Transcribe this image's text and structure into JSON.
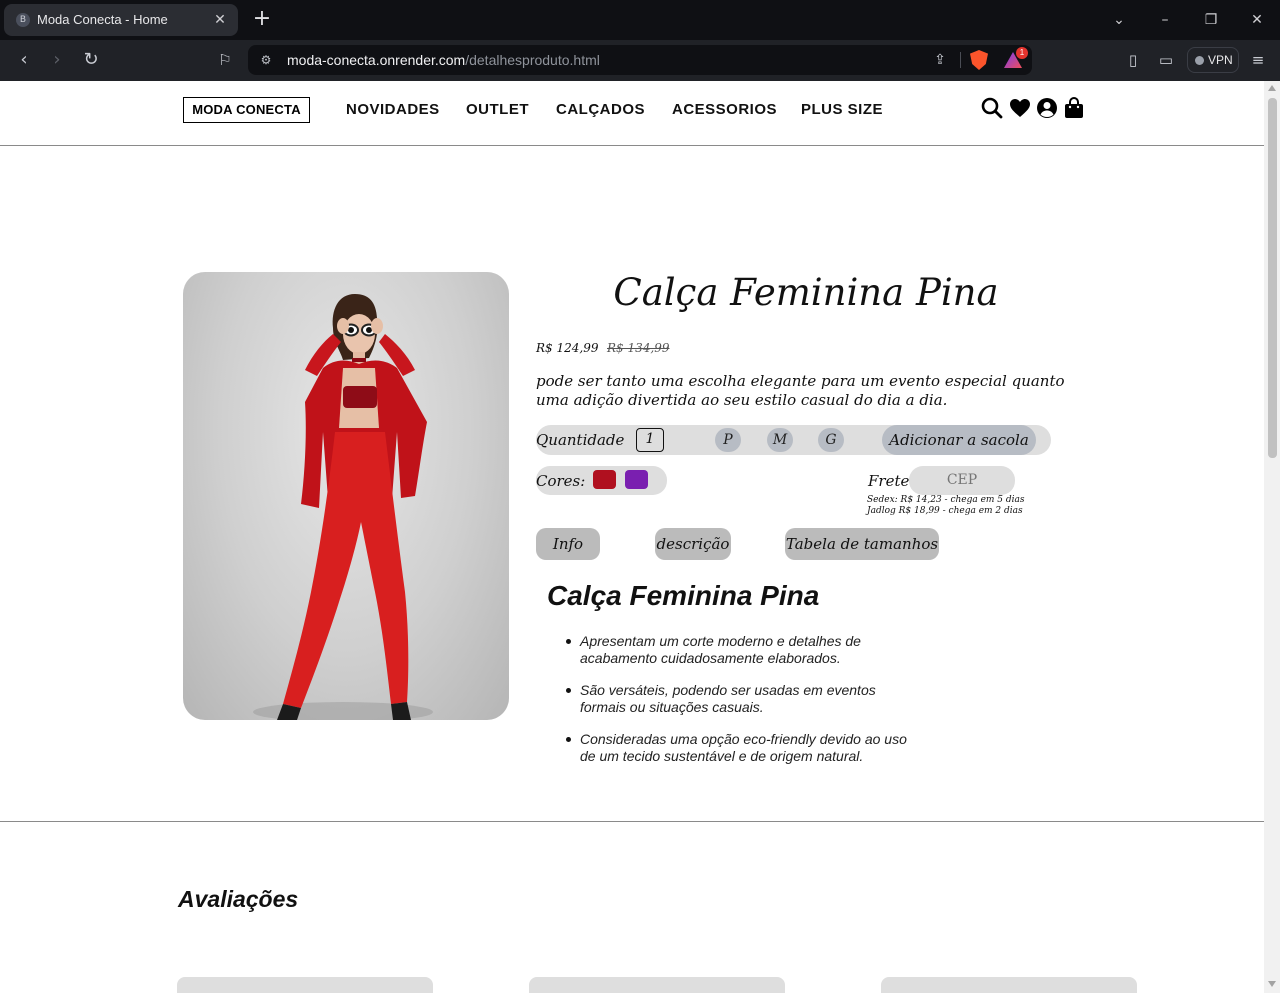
{
  "browser": {
    "tab_title": "Moda Conecta - Home",
    "tab_favicon": "B",
    "url_host": "moda-conecta.onrender.com",
    "url_path": "/detalhesproduto.html",
    "rewards_count": "1",
    "vpn_label": "VPN"
  },
  "header": {
    "logo": "MODA CONECTA",
    "menu": [
      "NOVIDADES",
      "OUTLET",
      "CALÇADOS",
      "ACESSORIOS",
      "PLUS SIZE"
    ]
  },
  "product": {
    "title": "Calça Feminina Pina",
    "price_now": "R$ 124,99",
    "price_old": "R$ 134,99",
    "description": "pode ser tanto uma escolha elegante para um evento especial quanto uma adição divertida ao seu estilo casual do dia a dia.",
    "quantity_label": "Quantidade",
    "quantity_value": "1",
    "sizes": [
      "P",
      "M",
      "G"
    ],
    "add_to_bag": "Adicionar a sacola",
    "colors_label": "Cores:",
    "colors": [
      "#b0101f",
      "#7a1fb0"
    ],
    "frete_label": "Frete:",
    "cep_placeholder": "CEP",
    "shipping": [
      "Sedex: R$ 14,23 - chega em 5 dias",
      "Jadlog R$ 18,99 - chega em 2 dias"
    ],
    "tabs": [
      "Info",
      "descrição",
      "Tabela de tamanhos"
    ]
  },
  "info": {
    "title": "Calça Feminina Pina",
    "bullets": [
      "Apresentam um corte moderno e detalhes de acabamento cuidadosamente elaborados.",
      "São versáteis, podendo ser usadas em eventos formais ou situações casuais.",
      "Consideradas uma opção eco-friendly devido ao uso de um tecido sustentável e de origem natural."
    ]
  },
  "reviews": {
    "title": "Avaliações"
  }
}
